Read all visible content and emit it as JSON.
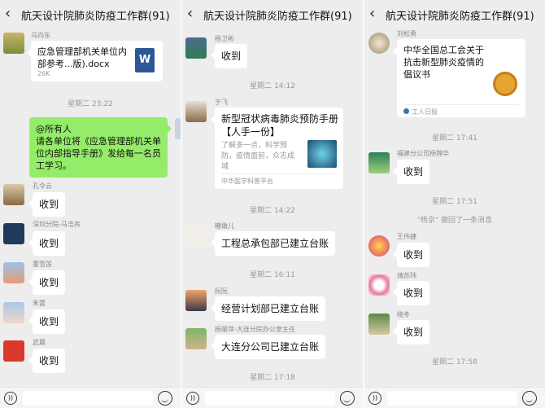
{
  "title": "航天设计院肺炎防疫工作群(91)",
  "panel1": {
    "m1": {
      "sender": "马向东",
      "file_name": "应急管理部机关单位内部参考...版).docx",
      "file_size": "26K",
      "file_badge": "W"
    },
    "time1": "星期二 23:22",
    "m2": {
      "text": "@所有人\n请各单位将《应急管理部机关单位内部指导手册》发给每一名员工学习。"
    },
    "replies": [
      {
        "sender": "孔令云",
        "text": "收到"
      },
      {
        "sender": "深圳分院-马浩亮",
        "text": "收到"
      },
      {
        "sender": "董雪莲",
        "text": "收到"
      },
      {
        "sender": "朱蕾",
        "text": "收到"
      },
      {
        "sender": "武晨",
        "text": "收到"
      }
    ]
  },
  "panel2": {
    "m1": {
      "sender": "杨卫彬",
      "text": "收到"
    },
    "time1": "星期二 14:12",
    "m2": {
      "sender": "于飞",
      "card_title": "新型冠状病毒肺炎预防手册【人手一份】",
      "card_desc": "了解多一点，科学预防，疫情面前，众志成城",
      "card_src": "中华医学科普平台"
    },
    "time2": "星期二 14:22",
    "m3": {
      "sender": "糖墩儿",
      "text": "工程总承包部已建立台账"
    },
    "time3": "星期二 16:11",
    "m4": {
      "sender": "阮阮",
      "text": "经营计划部已建立台账"
    },
    "m5": {
      "sender": "杨丽萍-大连分院办公室主任",
      "text": "大连分公司已建立台账"
    },
    "time4": "星期二 17:18"
  },
  "panel3": {
    "m1": {
      "sender": "刘松勇",
      "card_title": "中华全国总工会关于抗击新型肺炎疫情的倡议书",
      "card_src": "工人日报"
    },
    "time1": "星期二 17:41",
    "m2": {
      "sender": "福建分公司杨锦华",
      "text": "收到"
    },
    "time2": "星期二 17:51",
    "notice": "\"杨京\" 撤回了一条消息",
    "m3": {
      "sender": "王伟捷",
      "text": "收到"
    },
    "m4": {
      "sender": "靖苏玮",
      "text": "收到"
    },
    "m5": {
      "sender": "晓冬",
      "text": "收到"
    },
    "time3": "星期二 17:58"
  },
  "colors": {
    "bubble_green": "#95ec69",
    "bg": "#ededed",
    "word_blue": "#2b5797"
  },
  "icons": {
    "back": "chevron-left-icon",
    "voice": "voice-icon",
    "emoji": "emoji-icon"
  }
}
